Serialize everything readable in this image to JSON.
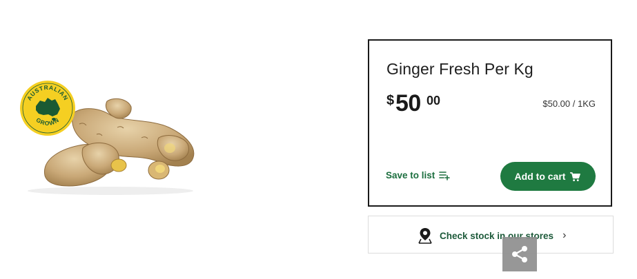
{
  "product": {
    "title": "Ginger Fresh Per Kg",
    "price_currency": "$",
    "price_dollars": "50",
    "price_cents": "00",
    "unit_price": "$50.00 / 1KG",
    "badge": {
      "top_text": "AUSTRALIAN",
      "bottom_text": "GROWN"
    }
  },
  "actions": {
    "save_to_list": "Save to list",
    "add_to_cart": "Add to cart",
    "check_stock": "Check stock in our stores"
  },
  "colors": {
    "brand_green": "#1f7a41",
    "badge_yellow": "#f5cf22"
  }
}
